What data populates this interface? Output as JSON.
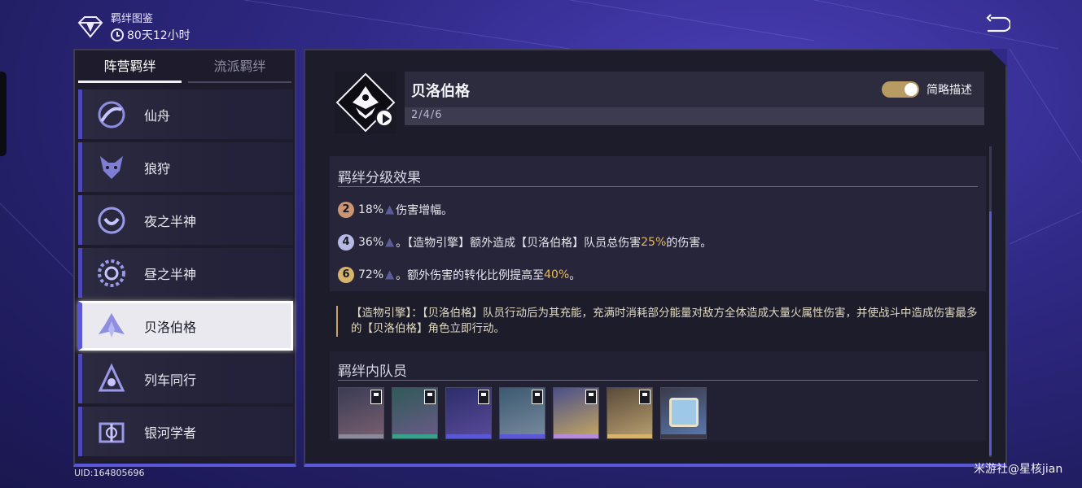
{
  "header": {
    "title": "羁绊图鉴",
    "timer": "80天12小时"
  },
  "tabs": {
    "active": "阵营羁绊",
    "inactive": "流派羁绊"
  },
  "factions": [
    {
      "name": "仙舟",
      "icon": "xianzhou-icon"
    },
    {
      "name": "狼狩",
      "icon": "wolf-icon"
    },
    {
      "name": "夜之半神",
      "icon": "moon-icon"
    },
    {
      "name": "昼之半神",
      "icon": "sun-icon"
    },
    {
      "name": "贝洛伯格",
      "icon": "belobog-icon",
      "selected": true
    },
    {
      "name": "列车同行",
      "icon": "train-icon"
    },
    {
      "name": "银河学者",
      "icon": "scholar-icon"
    }
  ],
  "uid": "UID:164805696",
  "bond": {
    "name": "贝洛伯格",
    "tiers": "2/4/6",
    "toggle_label": "简略描述",
    "toggle_on": true
  },
  "effects": {
    "title": "羁绊分级效果",
    "rows": [
      {
        "tier": "2",
        "pre": "18%",
        "post": "伤害增幅。",
        "highlight1": "",
        "mid": "",
        "highlight2": "",
        "end": ""
      },
      {
        "tier": "4",
        "pre": "36%",
        "post": "。【造物引擎】额外造成【贝洛伯格】队员总伤害",
        "highlight1": "25%",
        "mid": "的伤害。",
        "highlight2": "",
        "end": ""
      },
      {
        "tier": "6",
        "pre": "72%",
        "post": "。额外伤害的转化比例提高至",
        "highlight1": "40%",
        "mid": "。",
        "highlight2": "",
        "end": ""
      }
    ]
  },
  "note": "【造物引擎】：【贝洛伯格】队员行动后为其充能，充满时消耗部分能量对敌方全体造成大量火属性伤害，并使战斗中造成伤害最多的【贝洛伯格】角色立即行动。",
  "members": {
    "title": "羁绊内队员",
    "list": [
      {
        "name": "member-1",
        "colors": [
          "#3a3b55",
          "#7a6070"
        ],
        "strip": "#8a8a9a"
      },
      {
        "name": "member-2",
        "colors": [
          "#2f5a58",
          "#6c5a88"
        ],
        "strip": "#3aa08a"
      },
      {
        "name": "member-3",
        "colors": [
          "#2c2e6a",
          "#5a4a9a"
        ],
        "strip": "#5b58d8"
      },
      {
        "name": "member-4",
        "colors": [
          "#3b5a70",
          "#7a8aa0"
        ],
        "strip": "#5b58d8"
      },
      {
        "name": "member-5",
        "colors": [
          "#4a4f8a",
          "#c7a860"
        ],
        "strip": "#b48cd8"
      },
      {
        "name": "member-6",
        "colors": [
          "#5a4a3a",
          "#b8a070"
        ],
        "strip": "#d7b46e"
      },
      {
        "name": "member-7",
        "colors": [
          "#3a3a4a",
          "#5a7ab0"
        ],
        "strip": "#3a3a4a"
      }
    ]
  },
  "watermark": "米游社@星核jian"
}
